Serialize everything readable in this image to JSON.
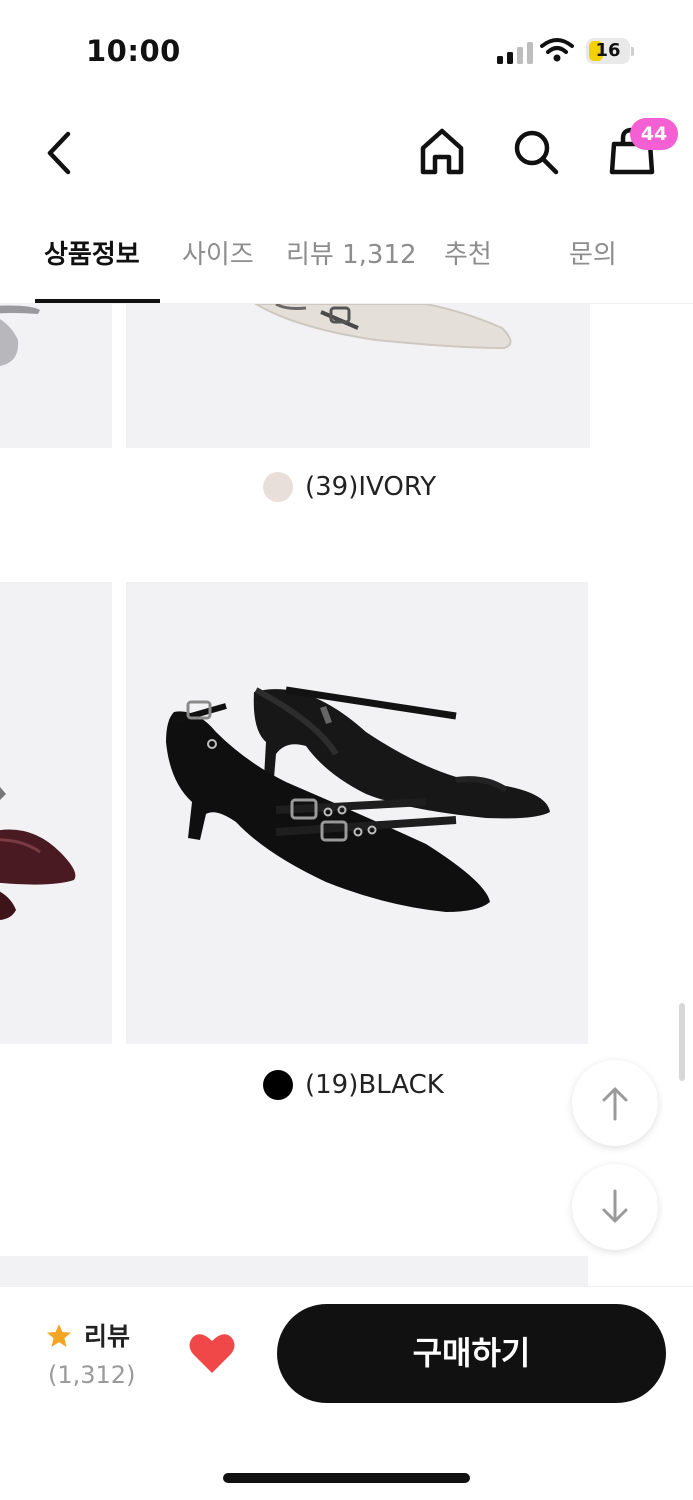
{
  "status_bar": {
    "time": "10:00",
    "battery": "16",
    "icons": [
      "signal-icon",
      "wifi-icon",
      "battery-icon"
    ]
  },
  "header": {
    "icons": [
      "back-icon",
      "home-icon",
      "search-icon",
      "shopping-bag-icon"
    ],
    "cart_badge": "44"
  },
  "tabs": [
    {
      "label": "상품정보",
      "active": true
    },
    {
      "label": "사이즈",
      "active": false
    },
    {
      "label": "리뷰 1,312",
      "active": false
    },
    {
      "label": "추천",
      "active": false
    },
    {
      "label": "문의",
      "active": false
    }
  ],
  "products": [
    {
      "color_label": "(39)IVORY",
      "swatch": "#e8dfdb"
    },
    {
      "color_label": "(19)BLACK",
      "swatch": "#000000"
    }
  ],
  "scroll_buttons": {
    "icons": [
      "arrow-up-icon",
      "arrow-down-icon"
    ]
  },
  "bottom_bar": {
    "review_label": "리뷰",
    "review_count": "(1,312)",
    "buy_label": "구매하기",
    "colors": {
      "star": "#f5a524",
      "heart": "#f04848",
      "buy_bg": "#111111",
      "badge": "#f45fd4"
    }
  }
}
